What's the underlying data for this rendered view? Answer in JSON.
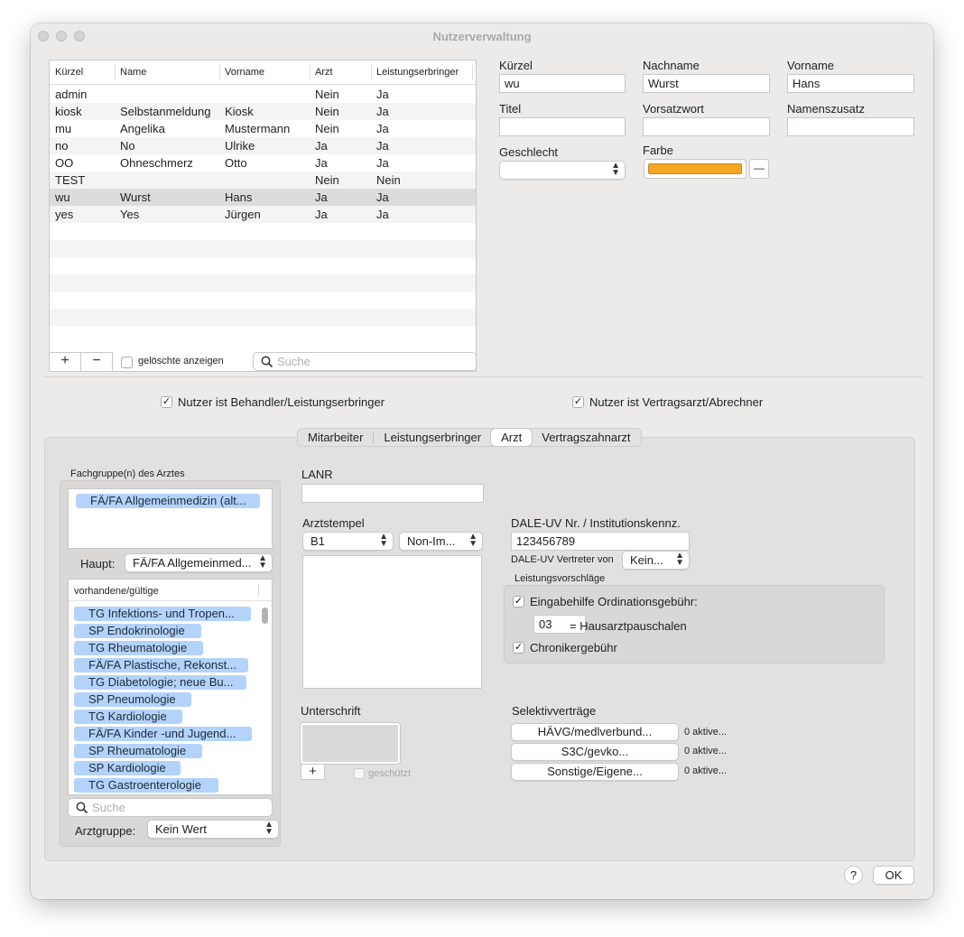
{
  "window": {
    "title": "Nutzerverwaltung"
  },
  "users_table": {
    "columns": [
      "Kürzel",
      "Name",
      "Vorname",
      "Arzt",
      "Leistungserbringer"
    ],
    "rows": [
      [
        "admin",
        "",
        "",
        "Nein",
        "Ja"
      ],
      [
        "kiosk",
        "Selbstanmeldung",
        "Kiosk",
        "Nein",
        "Ja"
      ],
      [
        "mu",
        "Angelika",
        "Mustermann",
        "Nein",
        "Ja"
      ],
      [
        "no",
        "No",
        "Ulrike",
        "Ja",
        "Ja"
      ],
      [
        "OO",
        "Ohneschmerz",
        "Otto",
        "Ja",
        "Ja"
      ],
      [
        "TEST",
        "",
        "",
        "Nein",
        "Nein"
      ],
      [
        "wu",
        "Wurst",
        "Hans",
        "Ja",
        "Ja"
      ],
      [
        "yes",
        "Yes",
        "Jürgen",
        "Ja",
        "Ja"
      ]
    ],
    "selected_row": 6,
    "add_label": "+",
    "remove_label": "−",
    "show_deleted_label": "gelöschte anzeigen",
    "search_placeholder": "Suche"
  },
  "form": {
    "kuerzel_label": "Kürzel",
    "kuerzel_value": "wu",
    "nachname_label": "Nachname",
    "nachname_value": "Wurst",
    "vorname_label": "Vorname",
    "vorname_value": "Hans",
    "titel_label": "Titel",
    "titel_value": "",
    "vorsatzwort_label": "Vorsatzwort",
    "vorsatzwort_value": "",
    "namenszusatz_label": "Namenszusatz",
    "namenszusatz_value": "",
    "geschlecht_label": "Geschlecht",
    "geschlecht_value": "",
    "farbe_label": "Farbe",
    "farbe_color": "#f5a623",
    "farbe_clear_label": "—"
  },
  "options": {
    "behandler_label": "Nutzer ist Behandler/Leistungserbringer",
    "behandler_checked": true,
    "vertragsarzt_label": "Nutzer ist Vertragsarzt/Abrechner",
    "vertragsarzt_checked": true
  },
  "tabs": [
    {
      "label": "Mitarbeiter",
      "active": false
    },
    {
      "label": "Leistungserbringer",
      "active": false
    },
    {
      "label": "Arzt",
      "active": true
    },
    {
      "label": "Vertragszahnarzt",
      "active": false
    }
  ],
  "arzt": {
    "fachgruppen_label": "Fachgruppe(n) des Arztes",
    "selected_fachgruppen": [
      "FÄ/FA Allgemeinmedizin (alt..."
    ],
    "haupt_label": "Haupt:",
    "haupt_value": "FÄ/FA Allgemeinmed...",
    "available_header": "vorhandene/gültige",
    "available": [
      "TG Infektions- und Tropen...",
      "SP Endokrinologie",
      "TG Rheumatologie",
      "FÄ/FA Plastische, Rekonst...",
      "TG Diabetologie; neue Bu...",
      "SP Pneumologie",
      "TG Kardiologie",
      "FÄ/FA Kinder -und Jugend...",
      "SP Rheumatologie",
      "SP Kardiologie",
      "TG Gastroenterologie"
    ],
    "fach_search_placeholder": "Suche",
    "arztgruppe_label": "Arztgruppe:",
    "arztgruppe_value": "Kein Wert",
    "lanr_label": "LANR",
    "lanr_value": "",
    "arztstempel_label": "Arztstempel",
    "stempel_select_1": "B1",
    "stempel_select_2": "Non-Im...",
    "unterschrift_label": "Unterschrift",
    "unterschrift_add": "+",
    "geschuetzt_label": "geschützt",
    "dale_label": "DALE-UV Nr. / Institutionskennz.",
    "dale_value": "123456789",
    "dale_vertreter_label": "DALE-UV Vertreter von",
    "dale_vertreter_value": "Kein...",
    "leistungsvorschlaege_label": "Leistungsvorschläge",
    "eingabehilfe_label": "Eingabehilfe Ordinationsgebühr:",
    "eingabehilfe_checked": true,
    "hausarzt_value": "03",
    "hausarzt_label": "= Hausarztpauschalen",
    "chroniker_label": "Chronikergebühr",
    "chroniker_checked": true,
    "selektiv_label": "Selektivverträge",
    "selektiv": [
      {
        "button": "HÄVG/medlverbund...",
        "status": "0 aktive..."
      },
      {
        "button": "S3C/gevko...",
        "status": "0 aktive..."
      },
      {
        "button": "Sonstige/Eigene...",
        "status": "0 aktive..."
      }
    ]
  },
  "footer": {
    "help_label": "?",
    "ok_label": "OK"
  },
  "colors": {
    "token_bg": "#b4d3fa",
    "selection_row": "#dcdcdc",
    "window_bg": "#ecebea"
  },
  "icons": [
    "search-icon",
    "checkmark-icon",
    "chevron-updown-icon"
  ]
}
